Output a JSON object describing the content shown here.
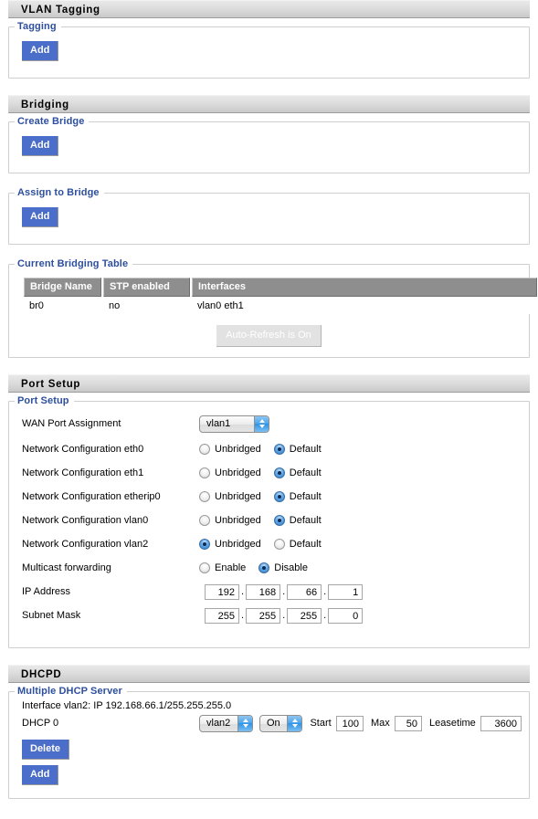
{
  "sections": {
    "vlan_tagging": {
      "title": "VLAN Tagging",
      "tagging": {
        "legend": "Tagging",
        "add_label": "Add"
      }
    },
    "bridging": {
      "title": "Bridging",
      "create_bridge": {
        "legend": "Create Bridge",
        "add_label": "Add"
      },
      "assign_to_bridge": {
        "legend": "Assign to Bridge",
        "add_label": "Add"
      },
      "current_bridging_table": {
        "legend": "Current Bridging Table",
        "columns": [
          "Bridge Name",
          "STP enabled",
          "Interfaces"
        ],
        "rows": [
          {
            "bridge_name": "br0",
            "stp_enabled": "no",
            "interfaces": "vlan0 eth1"
          }
        ],
        "auto_refresh_label": "Auto-Refresh is On"
      }
    },
    "port_setup": {
      "title": "Port Setup",
      "legend": "Port Setup",
      "wan_port_assignment": {
        "label": "WAN Port Assignment",
        "value": "vlan1"
      },
      "network_configs": [
        {
          "label": "Network Configuration eth0",
          "options": [
            "Unbridged",
            "Default"
          ],
          "selected": "Default"
        },
        {
          "label": "Network Configuration eth1",
          "options": [
            "Unbridged",
            "Default"
          ],
          "selected": "Default"
        },
        {
          "label": "Network Configuration etherip0",
          "options": [
            "Unbridged",
            "Default"
          ],
          "selected": "Default"
        },
        {
          "label": "Network Configuration vlan0",
          "options": [
            "Unbridged",
            "Default"
          ],
          "selected": "Default"
        },
        {
          "label": "Network Configuration vlan2",
          "options": [
            "Unbridged",
            "Default"
          ],
          "selected": "Unbridged"
        }
      ],
      "multicast_forwarding": {
        "label": "Multicast forwarding",
        "options": [
          "Enable",
          "Disable"
        ],
        "selected": "Disable"
      },
      "ip_address": {
        "label": "IP Address",
        "octets": [
          "192",
          "168",
          "66",
          "1"
        ]
      },
      "subnet_mask": {
        "label": "Subnet Mask",
        "octets": [
          "255",
          "255",
          "255",
          "0"
        ]
      }
    },
    "dhcpd": {
      "title": "DHCPD",
      "legend": "Multiple DHCP Server",
      "interface_line": "Interface vlan2: IP 192.168.66.1/255.255.255.0",
      "entry": {
        "label": "DHCP 0",
        "interface_value": "vlan2",
        "state_value": "On",
        "start_label": "Start",
        "start_value": "100",
        "max_label": "Max",
        "max_value": "50",
        "leasetime_label": "Leasetime",
        "leasetime_value": "3600"
      },
      "delete_label": "Delete",
      "add_label": "Add"
    }
  },
  "colors": {
    "accent_blue": "#4a6ec9",
    "legend_blue": "#2d4f9e",
    "table_header_gray": "#8e8e8e",
    "section_bar_gray": "#dedede"
  }
}
